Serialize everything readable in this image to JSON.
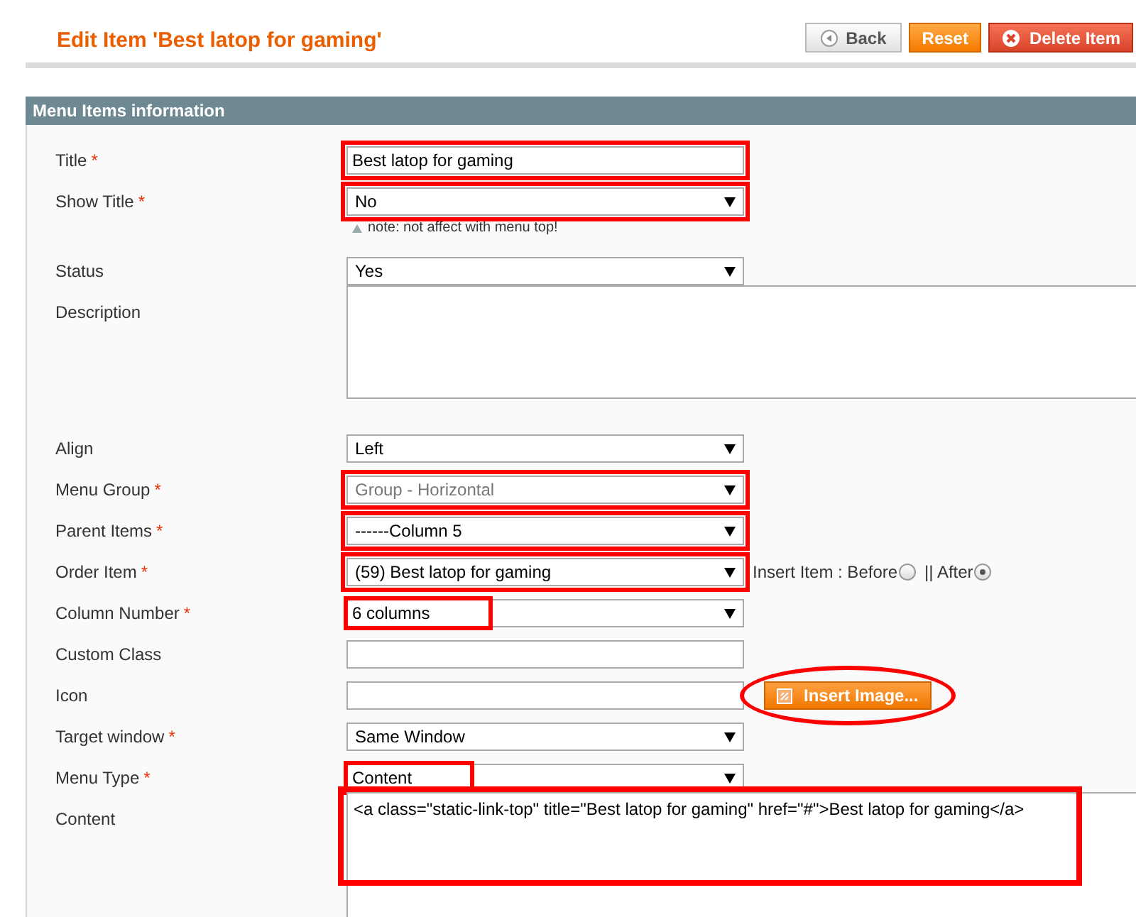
{
  "page_title": "Edit Item 'Best latop for gaming'",
  "buttons": [
    {
      "kind": "back",
      "label": "Back"
    },
    {
      "kind": "reset",
      "label": "Reset"
    },
    {
      "kind": "delete",
      "label": "Delete Item"
    }
  ],
  "section": {
    "title": "Menu Items information"
  },
  "fields": [
    {
      "kind": "text",
      "label": "Title",
      "required_mark": "*",
      "value": "Best latop for gaming",
      "annotation": {
        "kind": "field"
      }
    },
    {
      "kind": "select",
      "label": "Show Title",
      "required_mark": "*",
      "value": "No",
      "disabled": false,
      "annotation": {
        "kind": "field"
      },
      "note": "note: not affect with menu top!"
    },
    {
      "kind": "select",
      "label": "Status",
      "value": "Yes",
      "disabled": false
    },
    {
      "kind": "textarea",
      "label": "Description"
    },
    {
      "kind": "select",
      "label": "Align",
      "value": "Left",
      "disabled": false
    },
    {
      "kind": "select",
      "label": "Menu Group",
      "required_mark": "*",
      "value": "Group - Horizontal",
      "disabled": true,
      "annotation": {
        "kind": "field"
      }
    },
    {
      "kind": "select",
      "label": "Parent Items",
      "required_mark": "*",
      "value": "------Column 5",
      "disabled": false,
      "annotation": {
        "kind": "field"
      }
    },
    {
      "kind": "order",
      "label": "Order Item",
      "required_mark": "*",
      "value": "(59) Best latop for gaming",
      "disabled": false,
      "annotation": {
        "kind": "field"
      },
      "insert_label": "Insert Item : Before",
      "separator": "|| After",
      "options": [
        {
          "selected": false
        },
        {
          "selected": true
        }
      ]
    },
    {
      "kind": "select",
      "label": "Column Number",
      "required_mark": "*",
      "value": "6 columns",
      "disabled": false,
      "annotation": {
        "kind": "value"
      }
    },
    {
      "kind": "text",
      "label": "Custom Class"
    },
    {
      "kind": "image",
      "label": "Icon",
      "button": "Insert Image...",
      "annotation": {
        "kind": "circle"
      }
    },
    {
      "kind": "select",
      "label": "Target window",
      "required_mark": "*",
      "value": "Same Window",
      "disabled": false
    },
    {
      "kind": "select",
      "label": "Menu Type",
      "required_mark": "*",
      "value": "Content",
      "disabled": false,
      "annotation": {
        "kind": "value"
      }
    },
    {
      "kind": "content",
      "label": "Content",
      "value": "<a class=\"static-link-top\" title=\"Best latop for gaming\" href=\"#\">Best latop for gaming</a>",
      "annotation": {
        "kind": "field"
      }
    }
  ]
}
